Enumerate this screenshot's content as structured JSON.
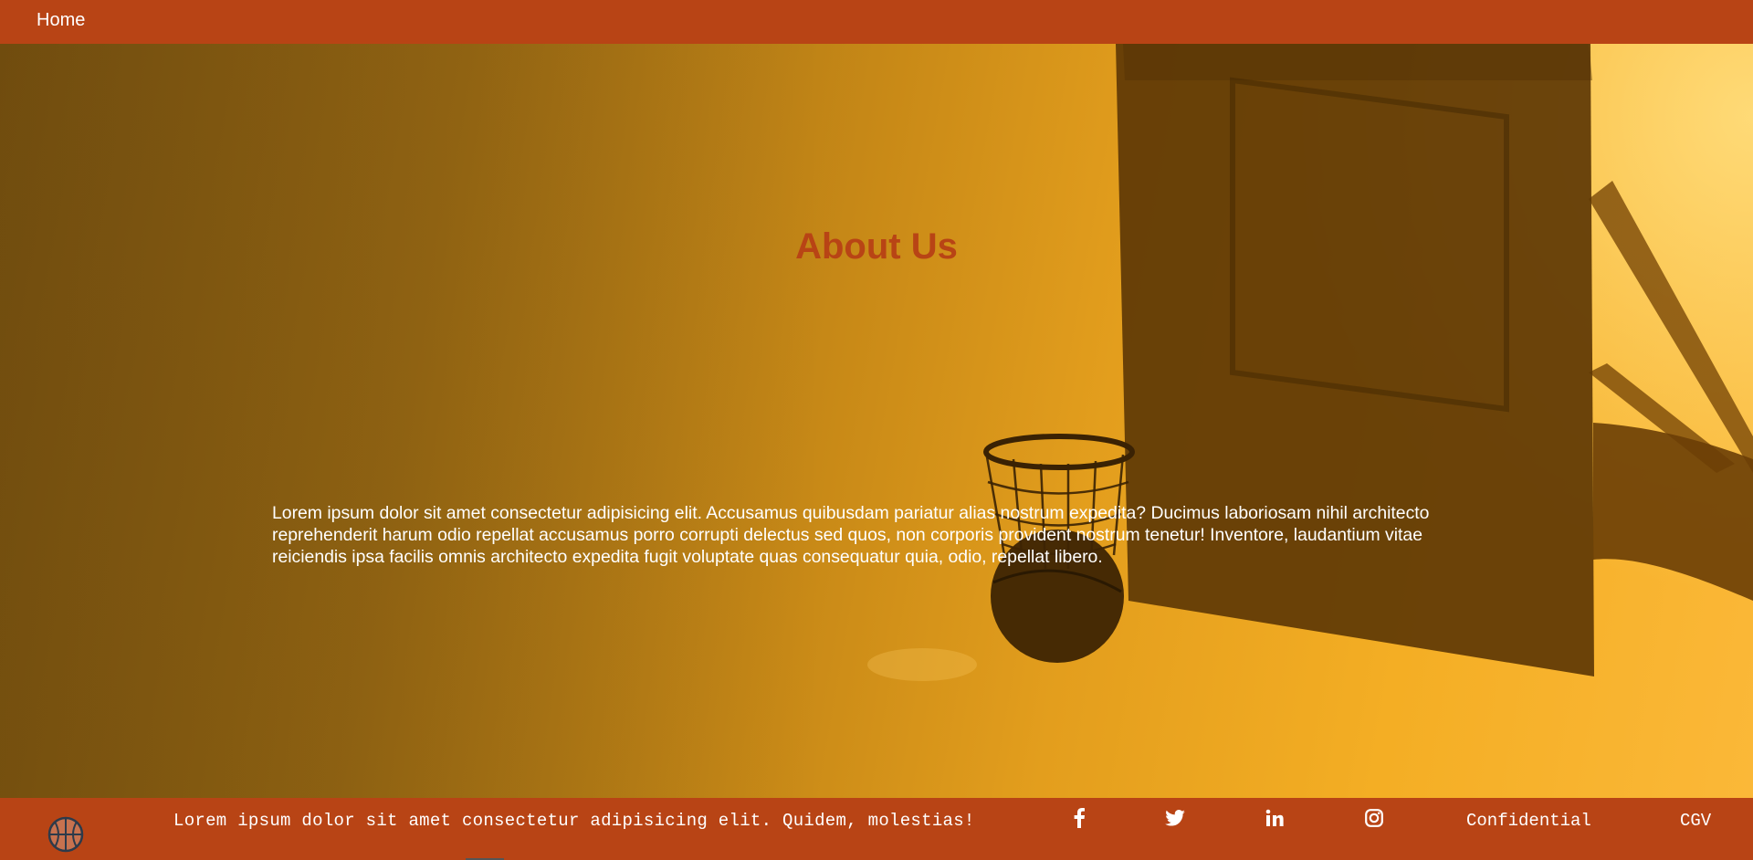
{
  "nav": {
    "home_label": "Home"
  },
  "hero": {
    "title": "About Us",
    "body": "Lorem ipsum dolor sit amet consectetur adipisicing elit. Accusamus quibusdam pariatur alias nostrum expedita? Ducimus laboriosam nihil architecto reprehenderit harum odio repellat accusamus porro corrupti delectus sed quos, non corporis provident nostrum tenetur! Inventore, laudantium vitae reiciendis ipsa facilis omnis architecto expedita fugit voluptate quas consequatur quia, odio, repellat libero."
  },
  "footer": {
    "logo_icon": "basketball-icon",
    "tagline": "Lorem ipsum dolor sit amet consectetur adipisicing elit. Quidem, molestias!",
    "social": [
      {
        "icon": "facebook-icon"
      },
      {
        "icon": "twitter-icon"
      },
      {
        "icon": "linkedin-icon"
      },
      {
        "icon": "instagram-icon"
      }
    ],
    "links": [
      "Confidential",
      "CGV"
    ]
  },
  "colors": {
    "brand": "#b84415",
    "title": "#b84415",
    "text": "#ffffff"
  }
}
